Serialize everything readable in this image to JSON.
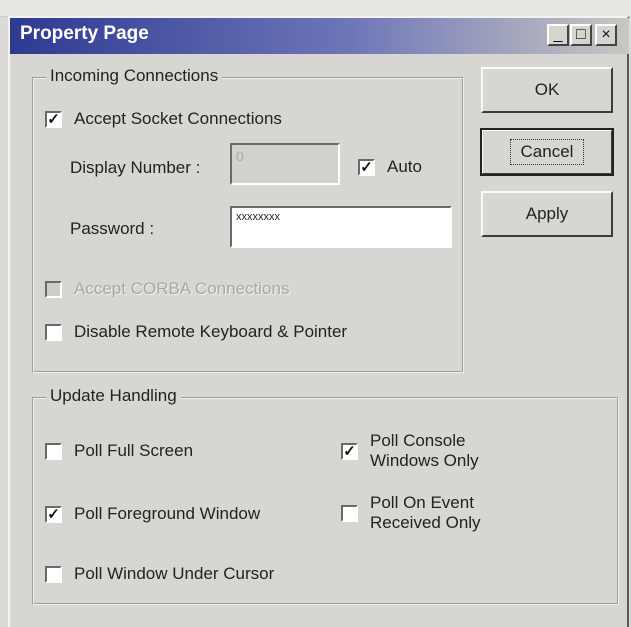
{
  "window": {
    "title": "Property Page"
  },
  "title_buttons": {
    "minimize": "_",
    "maximize": "□",
    "close": "×"
  },
  "incoming": {
    "legend": "Incoming Connections",
    "accept_socket": {
      "label": "Accept Socket Connections",
      "checked": true,
      "mark": "✓"
    },
    "display_number": {
      "label": "Display Number :",
      "value": "0"
    },
    "auto": {
      "label": "Auto",
      "checked": true,
      "mark": "✓"
    },
    "password": {
      "label": "Password :",
      "value": "xxxxxxxx"
    },
    "accept_corba": {
      "label": "Accept CORBA Connections",
      "checked": false,
      "enabled": false
    },
    "disable_remote": {
      "label": "Disable Remote Keyboard & Pointer",
      "checked": false
    }
  },
  "update": {
    "legend": "Update Handling",
    "poll_full": {
      "label": "Poll Full Screen",
      "checked": false
    },
    "poll_foreground": {
      "label": "Poll Foreground Window",
      "checked": true,
      "mark": "✓"
    },
    "poll_under_cursor": {
      "label": "Poll Window Under Cursor",
      "checked": false
    },
    "poll_console": {
      "line1": "Poll Console",
      "line2": "Windows Only",
      "checked": true,
      "mark": "✓"
    },
    "poll_event": {
      "line1": "Poll On Event",
      "line2": "Received Only",
      "checked": false
    }
  },
  "buttons": {
    "ok": "OK",
    "cancel": "Cancel",
    "apply": "Apply"
  }
}
